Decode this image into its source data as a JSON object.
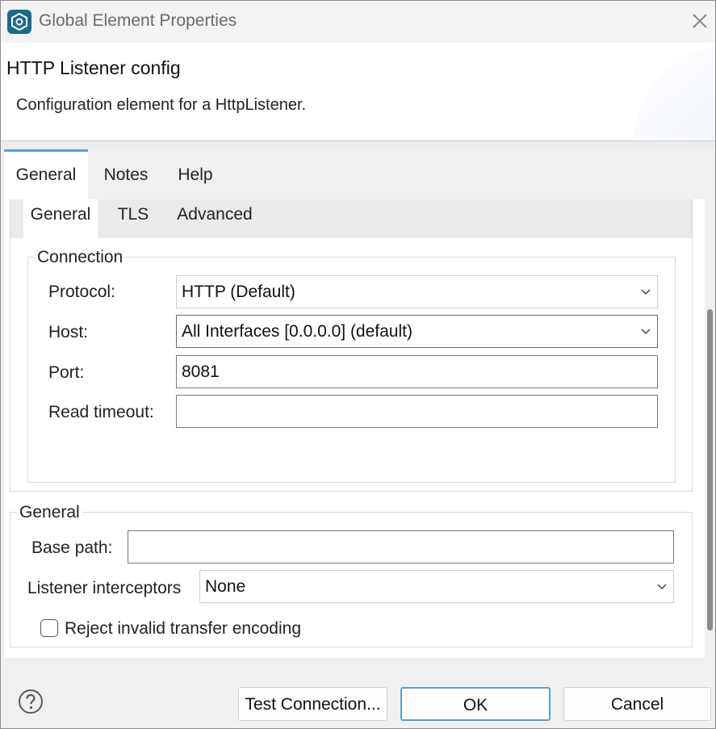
{
  "window": {
    "title": "Global Element Properties",
    "app_icon": "mule-studio-icon",
    "close_icon": "close-icon"
  },
  "header": {
    "title": "HTTP Listener config",
    "description": "Configuration element for a HttpListener."
  },
  "tabs": [
    {
      "label": "General",
      "active": true
    },
    {
      "label": "Notes",
      "active": false
    },
    {
      "label": "Help",
      "active": false
    }
  ],
  "inner_tabs": [
    {
      "label": "General",
      "active": true
    },
    {
      "label": "TLS",
      "active": false
    },
    {
      "label": "Advanced",
      "active": false
    }
  ],
  "connection": {
    "legend": "Connection",
    "protocol_label": "Protocol:",
    "protocol_value": "HTTP (Default)",
    "host_label": "Host:",
    "host_value": "All Interfaces [0.0.0.0] (default)",
    "port_label": "Port:",
    "port_value": "8081",
    "read_timeout_label": "Read timeout:",
    "read_timeout_value": ""
  },
  "general": {
    "legend": "General",
    "base_path_label": "Base path:",
    "base_path_value": "",
    "listener_interceptors_label": "Listener interceptors",
    "listener_interceptors_value": "None",
    "reject_invalid_label": "Reject invalid transfer encoding",
    "reject_invalid_checked": false
  },
  "footer": {
    "help_icon": "help-icon",
    "test_connection_label": "Test Connection...",
    "ok_label": "OK",
    "cancel_label": "Cancel"
  },
  "colors": {
    "accent": "#5aa0d8",
    "app_icon_bg": "#1e6a8c"
  }
}
